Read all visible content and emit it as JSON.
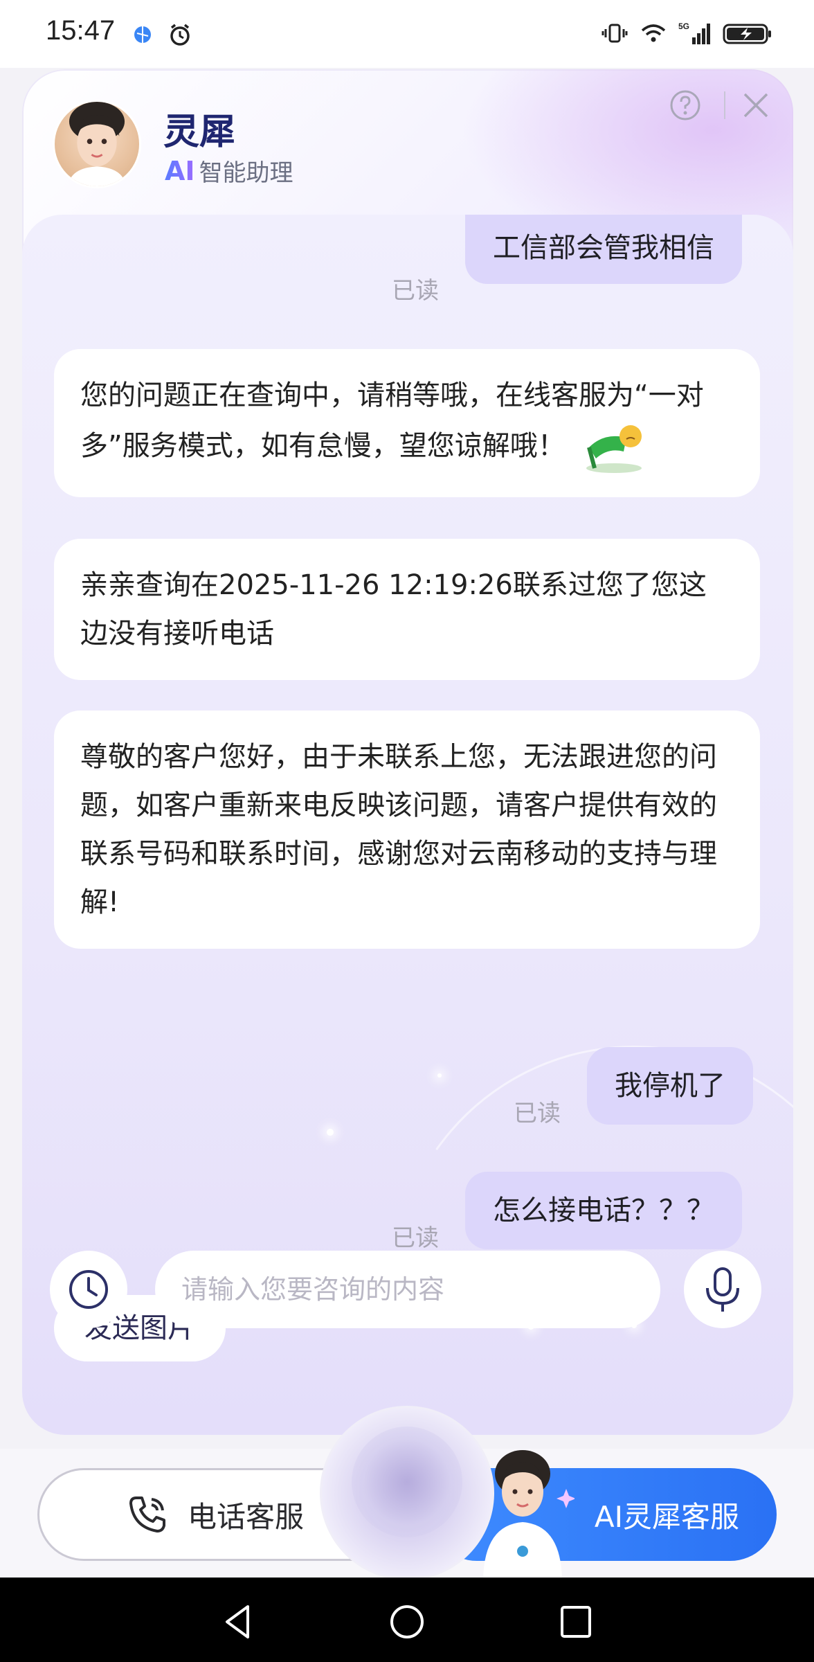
{
  "status_bar": {
    "time": "15:47",
    "icons": [
      "browser-icon",
      "alarm-icon",
      "vibrate-icon",
      "wifi-icon",
      "5g-signal-icon",
      "battery-charging-icon"
    ]
  },
  "header": {
    "name": "灵犀",
    "subtitle_ai": "AI",
    "subtitle_text": "智能助理"
  },
  "messages": [
    {
      "from": "user",
      "text": "工信部会管我相信",
      "read_label": "已读"
    },
    {
      "from": "bot",
      "text": "您的问题正在查询中，请稍等哦，在线客服为“一对多”服务模式，如有怠慢，望您谅解哦！"
    },
    {
      "from": "bot",
      "text": "亲亲查询在2025-11-26 12:19:26联系过您了您这边没有接听电话"
    },
    {
      "from": "bot",
      "text": "尊敬的客户您好，由于未联系上您，无法跟进您的问题，如客户重新来电反映该问题，请客户提供有效的联系号码和联系时间，感谢您对云南移动的支持与理解!"
    },
    {
      "from": "user",
      "text": "我停机了",
      "read_label": "已读"
    },
    {
      "from": "user",
      "text": "怎么接电话？？？",
      "read_label": "已读"
    }
  ],
  "quick_chip": "发送图片",
  "input": {
    "placeholder": "请输入您要咨询的内容"
  },
  "bottom": {
    "phone_label": "电话客服",
    "ai_label": "AI灵犀客服"
  },
  "colors": {
    "user_bubble": "#dcd6fb",
    "brand_navy": "#1f2670",
    "ai_button": "#2a71f4"
  }
}
